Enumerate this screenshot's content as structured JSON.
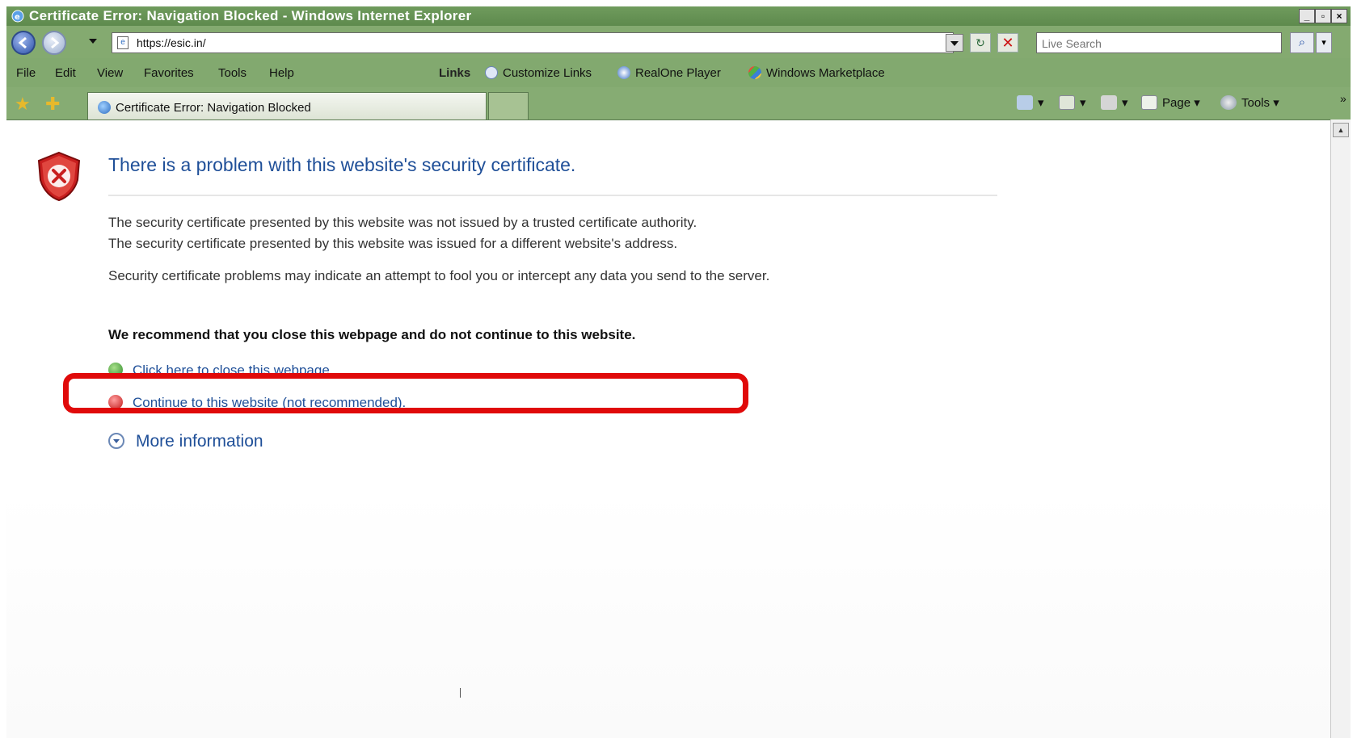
{
  "window": {
    "title": "Certificate Error: Navigation Blocked - Windows Internet Explorer",
    "minimize": "_",
    "maximize": "▫",
    "close": "×"
  },
  "address_bar": {
    "url": "https://esic.in/",
    "search_placeholder": "Live Search"
  },
  "menu": [
    "File",
    "Edit",
    "View",
    "Favorites",
    "Tools",
    "Help"
  ],
  "links": {
    "label": "Links",
    "items": [
      "Customize Links",
      "RealOne Player",
      "Windows Marketplace"
    ]
  },
  "tab": {
    "label": "Certificate Error: Navigation Blocked"
  },
  "command_bar": {
    "page": "Page",
    "tools": "Tools"
  },
  "content": {
    "heading": "There is a problem with this website's security certificate.",
    "para1": "The security certificate presented by this website was not issued by a trusted certificate authority.",
    "para2": "The security certificate presented by this website was issued for a different website's address.",
    "para3": "Security certificate problems may indicate an attempt to fool you or intercept any data you send to the server.",
    "recommend": "We recommend that you close this webpage and do not continue to this website.",
    "close_link": "Click here to close this webpage.",
    "continue_link": "Continue to this website (not recommended).",
    "more_info": "More information"
  },
  "colors": {
    "chrome_green": "#82a96f",
    "heading_blue": "#1f4f98",
    "highlight_red": "#e00a0a"
  }
}
